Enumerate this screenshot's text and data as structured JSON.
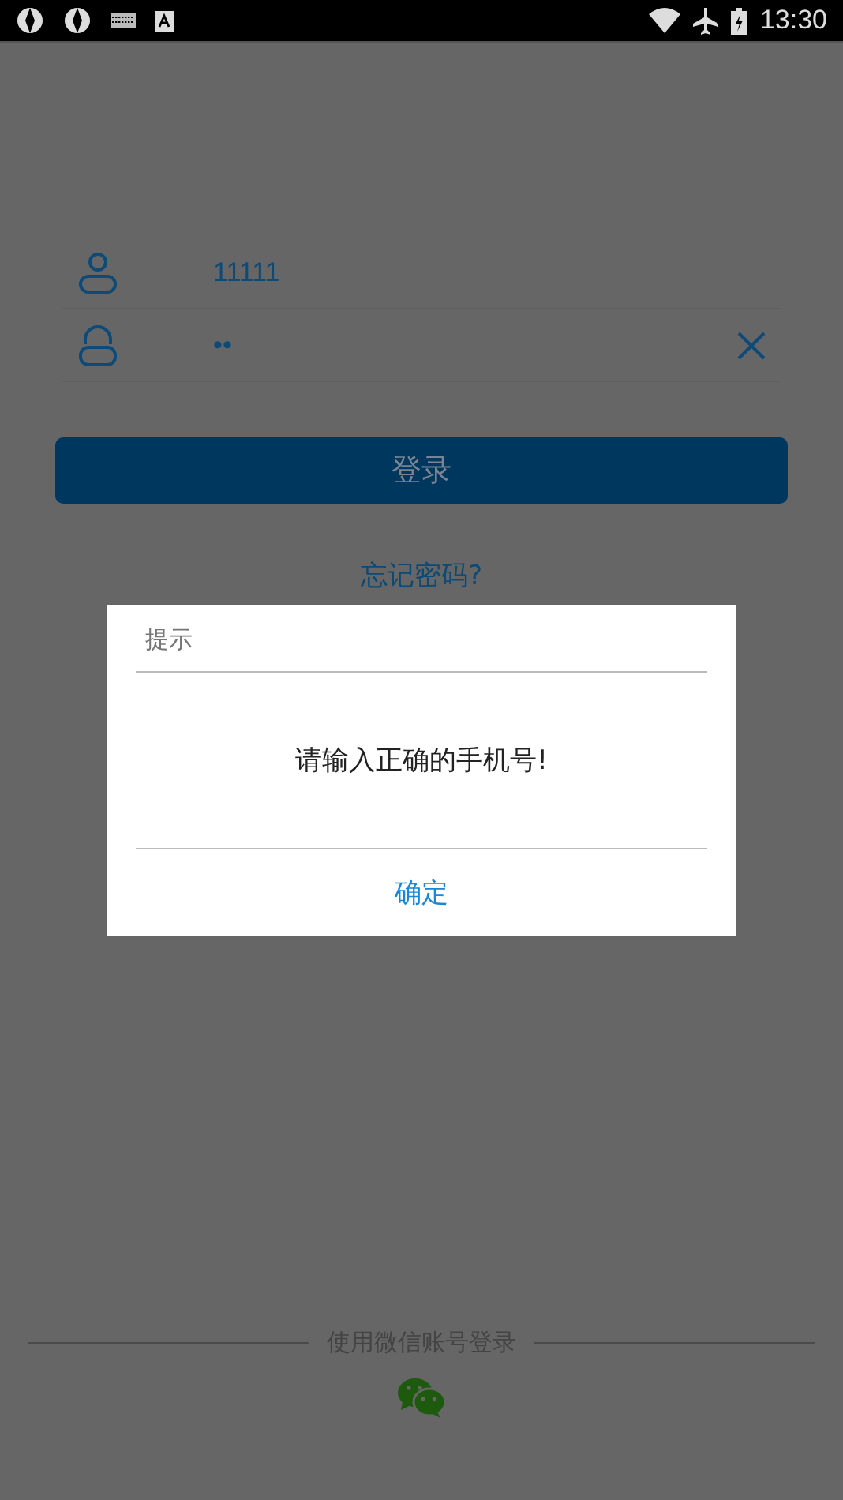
{
  "status_bar": {
    "time": "13:30"
  },
  "login_form": {
    "username": {
      "value": "11111"
    },
    "password": {
      "value": "••"
    },
    "submit_button": "登录",
    "forgot_password_link": "忘记密码?"
  },
  "wechat_login": {
    "label": "使用微信账号登录"
  },
  "dialog": {
    "title": "提示",
    "message": "请输入正确的手机号!",
    "confirm_button": "确定"
  }
}
